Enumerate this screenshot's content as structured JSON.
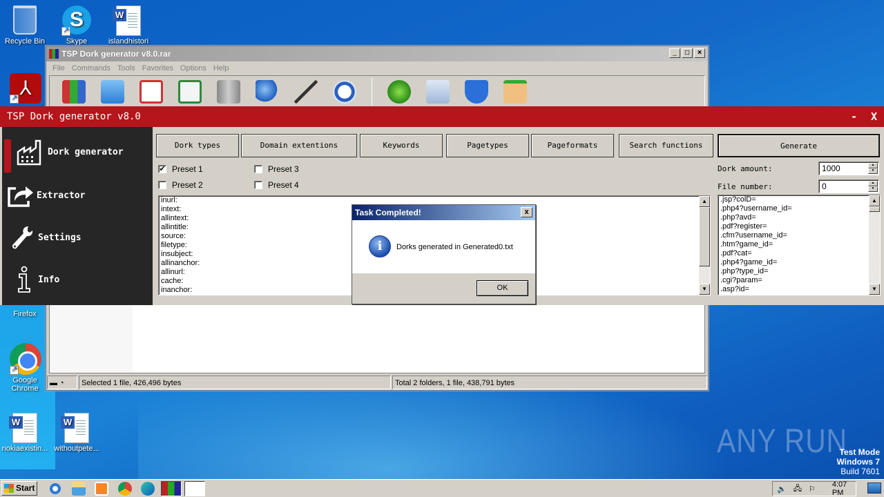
{
  "desktop": {
    "icons": [
      {
        "label": "Recycle Bin",
        "icon": "recycle-bin-icon"
      },
      {
        "label": "Skype",
        "icon": "skype-icon"
      },
      {
        "label": "islandhistori",
        "icon": "word-document-icon"
      },
      {
        "label": "",
        "icon": "acrobat-reader-icon"
      },
      {
        "label": "Firefox",
        "icon": "firefox-icon"
      },
      {
        "label": "Google Chrome",
        "icon": "chrome-icon"
      },
      {
        "label": "nokiaexistin...",
        "icon": "word-document-icon"
      },
      {
        "label": "withoutpete...",
        "icon": "word-document-icon"
      }
    ],
    "watermark": "ANY RUN",
    "test_mode": {
      "line1": "Test Mode",
      "line2": "Windows 7",
      "line3": "Build 7601"
    }
  },
  "rar_window": {
    "title": "TSP Dork generator v8.0.rar",
    "menu": [
      "File",
      "Commands",
      "Tools",
      "Favorites",
      "Options",
      "Help"
    ],
    "toolbar_icons": [
      "add-icon",
      "extract-to-icon",
      "test-icon",
      "view-icon",
      "delete-icon",
      "find-icon",
      "wizard-icon",
      "info-icon",
      "virus-scan-icon",
      "comment-icon",
      "protect-icon",
      "sfx-icon"
    ],
    "status_left": "Selected 1 file, 426,496 bytes",
    "status_right": "Total 2 folders, 1 file, 438,791 bytes"
  },
  "tsp": {
    "title": "TSP Dork generator v8.0",
    "minimize": "-",
    "close": "X",
    "sidebar": [
      {
        "label": "Dork generator",
        "icon": "factory-icon",
        "active": true
      },
      {
        "label": "Extractor",
        "icon": "export-icon",
        "active": false
      },
      {
        "label": "Settings",
        "icon": "wrench-icon",
        "active": false
      },
      {
        "label": "Info",
        "icon": "info-icon",
        "active": false
      }
    ],
    "tabs": [
      "Dork types",
      "Domain extentions",
      "Keywords",
      "Pagetypes",
      "Pageformats",
      "Search functions"
    ],
    "generate_label": "Generate",
    "presets": [
      {
        "label": "Preset 1",
        "checked": true
      },
      {
        "label": "Preset 2",
        "checked": false
      },
      {
        "label": "Preset 3",
        "checked": false
      },
      {
        "label": "Preset 4",
        "checked": false
      }
    ],
    "search_functions_list": [
      "inurl:",
      "intext:",
      "allintext:",
      "allintitle:",
      "source:",
      "filetype:",
      "insubject:",
      "allinanchor:",
      "allinurl:",
      "cache:",
      "inanchor:"
    ],
    "dork_amount_label": "Dork amount:",
    "dork_amount_value": "1000",
    "file_number_label": "File number:",
    "file_number_value": "0",
    "output_list": [
      ".jsp?colD=",
      ".php4?username_id=",
      ".php?avd=",
      ".pdf?register=",
      ".cfm?username_id=",
      ".htm?game_id=",
      ".pdf?cat=",
      ".php4?game_id=",
      ".php?type_id=",
      ".cgi?param=",
      ".asp?id="
    ]
  },
  "dialog": {
    "title": "Task Completed!",
    "message": "Dorks generated in Generated0.txt",
    "ok_label": "OK",
    "close_label": "x"
  },
  "taskbar": {
    "start_label": "Start",
    "clock": "4:07 PM"
  }
}
